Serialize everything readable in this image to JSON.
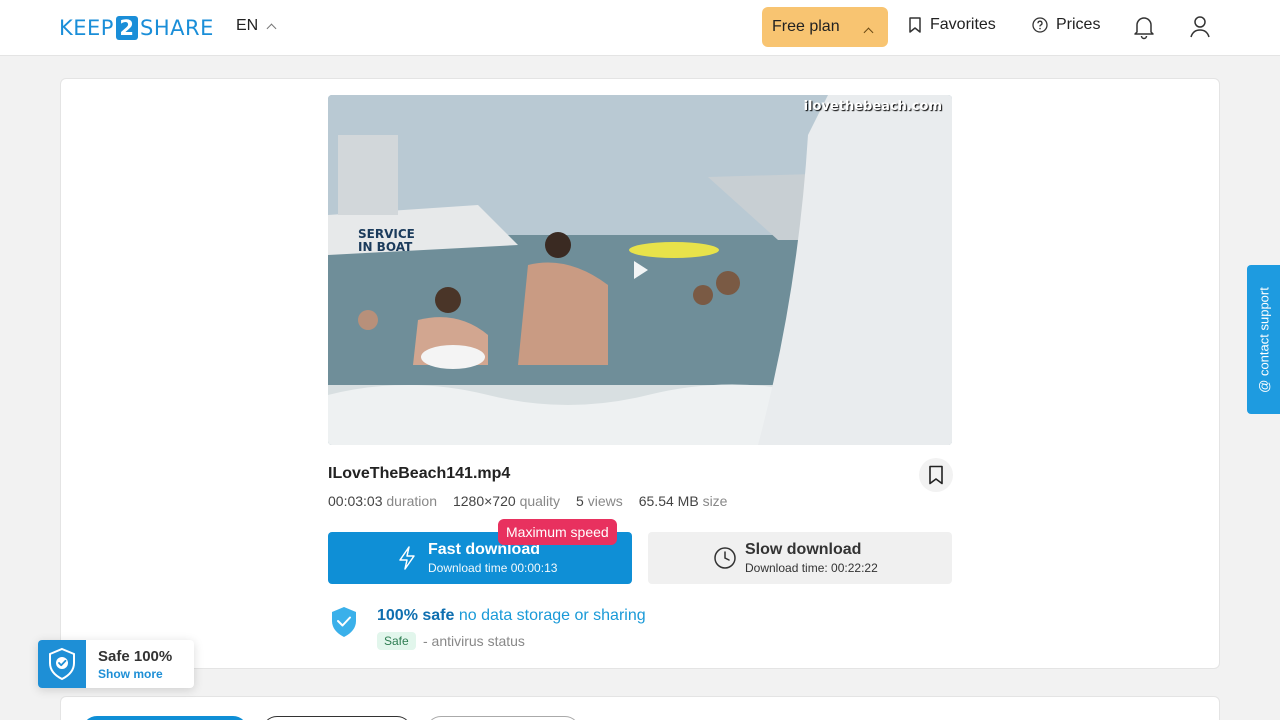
{
  "header": {
    "logo": {
      "left": "KEEP",
      "num": "2",
      "right": "SHARE"
    },
    "language": "EN",
    "plan": "Free plan",
    "favorites": "Favorites",
    "prices": "Prices"
  },
  "video": {
    "watermark": "ilovethebeach.com"
  },
  "file": {
    "name": "ILoveTheBeach141.mp4",
    "duration_value": "00:03:03",
    "duration_label": "duration",
    "quality_value": "1280×720",
    "quality_label": "quality",
    "views_value": "5",
    "views_label": "views",
    "size_value": "65.54 MB",
    "size_label": "size"
  },
  "download": {
    "badge": "Maximum speed",
    "fast_label": "Fast download",
    "fast_time": "Download time 00:00:13",
    "slow_label": "Slow download",
    "slow_time": "Download time: 00:22:22"
  },
  "safety": {
    "title_strong": "100% safe",
    "title_rest": "no data storage or sharing",
    "badge": "Safe",
    "status": "- antivirus status"
  },
  "contact": "@ contact support",
  "safe_widget": {
    "title": "Safe 100%",
    "link": "Show more"
  },
  "colors": {
    "accent": "#0f8fd6",
    "plan": "#f8c471",
    "badge": "#e8315f"
  }
}
